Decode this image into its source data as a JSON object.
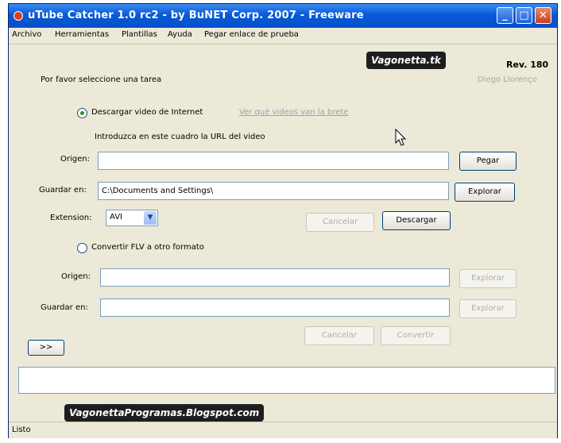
{
  "window": {
    "title": "uTube Catcher 1.0 rc2  -  by BuNET Corp. 2007 - Freeware",
    "minimize_glyph": "_",
    "maximize_glyph": "□",
    "close_glyph": "✕"
  },
  "menu": [
    "Archivo",
    "Herramientas",
    "Plantillas",
    "Ayuda",
    "Pegar enlace de prueba"
  ],
  "header": {
    "watermark": "Vagonetta.tk",
    "rev": "Rev. 180",
    "author": "Diego Llorenço",
    "prompt": "Por favor seleccione una tarea"
  },
  "download": {
    "radio_label": "Descargar video de Internet",
    "selected": true,
    "help_link": "Ver qué videos van la brete",
    "instruction": "Introduzca en este cuadro la URL del video",
    "origin_label": "Origen:",
    "origin_value": "",
    "paste_button": "Pegar",
    "save_label": "Guardar en:",
    "save_value": "C:\\Documents and Settings\\",
    "browse_button": "Explorar",
    "ext_label": "Extension:",
    "ext_value": "AVI",
    "cancel_button": "Cancelar",
    "download_button": "Descargar"
  },
  "convert": {
    "radio_label": "Convertir FLV a otro formato",
    "selected": false,
    "origin_label": "Origen:",
    "origin_value": "",
    "origin_browse": "Explorar",
    "save_label": "Guardar en:",
    "save_value": "",
    "save_browse": "Explorar",
    "cancel_button": "Cancelar",
    "convert_button": "Convertir"
  },
  "small_button": ">>",
  "footer_watermark": "VagonettaProgramas.Blogspot.com",
  "status": "Listo",
  "colors": {
    "titlebar": "#0450c8",
    "window_bg": "#ece9d8",
    "field_border": "#7f9db9"
  },
  "icons": [
    "app-icon",
    "minimize-icon",
    "maximize-icon",
    "close-icon",
    "chevron-down-icon",
    "mouse-cursor-icon"
  ]
}
